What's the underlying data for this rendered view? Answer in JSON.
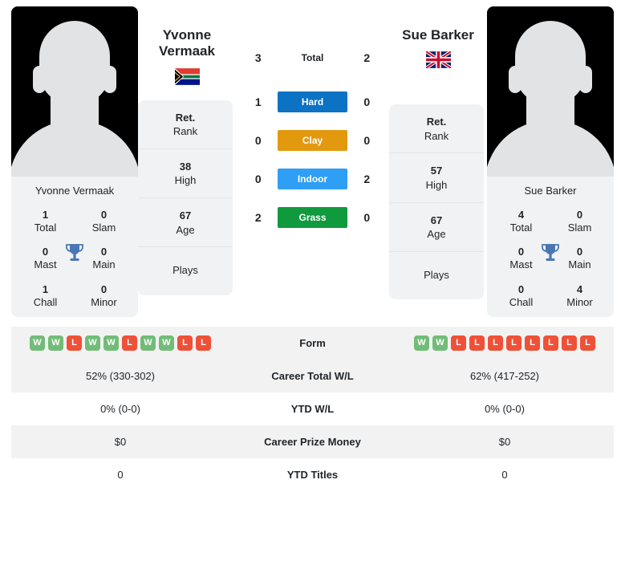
{
  "players": {
    "left": {
      "name": "Yvonne Vermaak",
      "name_line1": "Yvonne",
      "name_line2": "Vermaak",
      "flag": "south-africa-flag",
      "photo_caption": "Yvonne Vermaak",
      "titles": {
        "total_value": "1",
        "total_label": "Total",
        "slam_value": "0",
        "slam_label": "Slam",
        "mast_value": "0",
        "mast_label": "Mast",
        "main_value": "0",
        "main_label": "Main",
        "chall_value": "1",
        "chall_label": "Chall",
        "minor_value": "0",
        "minor_label": "Minor"
      },
      "card": [
        {
          "value": "Ret.",
          "label": "Rank"
        },
        {
          "value": "38",
          "label": "High"
        },
        {
          "value": "67",
          "label": "Age"
        },
        {
          "value": "",
          "label": "Plays"
        }
      ],
      "form": [
        "W",
        "W",
        "L",
        "W",
        "W",
        "L",
        "W",
        "W",
        "L",
        "L"
      ]
    },
    "right": {
      "name": "Sue Barker",
      "name_line1": "Sue Barker",
      "name_line2": "",
      "flag": "united-kingdom-flag",
      "photo_caption": "Sue Barker",
      "titles": {
        "total_value": "4",
        "total_label": "Total",
        "slam_value": "0",
        "slam_label": "Slam",
        "mast_value": "0",
        "mast_label": "Mast",
        "main_value": "0",
        "main_label": "Main",
        "chall_value": "0",
        "chall_label": "Chall",
        "minor_value": "4",
        "minor_label": "Minor"
      },
      "card": [
        {
          "value": "Ret.",
          "label": "Rank"
        },
        {
          "value": "57",
          "label": "High"
        },
        {
          "value": "67",
          "label": "Age"
        },
        {
          "value": "",
          "label": "Plays"
        }
      ],
      "form": [
        "W",
        "W",
        "L",
        "L",
        "L",
        "L",
        "L",
        "L",
        "L",
        "L"
      ]
    }
  },
  "head_to_head": [
    {
      "label": "Total",
      "left": "3",
      "right": "2",
      "badge": false,
      "color": ""
    },
    {
      "label": "Hard",
      "left": "1",
      "right": "0",
      "badge": true,
      "color": "#0b72c4"
    },
    {
      "label": "Clay",
      "left": "0",
      "right": "0",
      "badge": true,
      "color": "#e3990e"
    },
    {
      "label": "Indoor",
      "left": "0",
      "right": "2",
      "badge": true,
      "color": "#2f9ef5"
    },
    {
      "label": "Grass",
      "left": "2",
      "right": "0",
      "badge": true,
      "color": "#0f9a3e"
    }
  ],
  "stats_rows": [
    {
      "label": "Form",
      "left": "",
      "right": "",
      "type": "form"
    },
    {
      "label": "Career Total W/L",
      "left": "52% (330-302)",
      "right": "62% (417-252)",
      "type": "text"
    },
    {
      "label": "YTD W/L",
      "left": "0% (0-0)",
      "right": "0% (0-0)",
      "type": "text"
    },
    {
      "label": "Career Prize Money",
      "left": "$0",
      "right": "$0",
      "type": "text"
    },
    {
      "label": "YTD Titles",
      "left": "0",
      "right": "0",
      "type": "text"
    }
  ],
  "colors": {
    "hard": "#0b72c4",
    "clay": "#e3990e",
    "indoor": "#2f9ef5",
    "grass": "#0f9a3e",
    "win": "#72bc78",
    "loss": "#ef5138",
    "trophy": "#4a77b4"
  }
}
